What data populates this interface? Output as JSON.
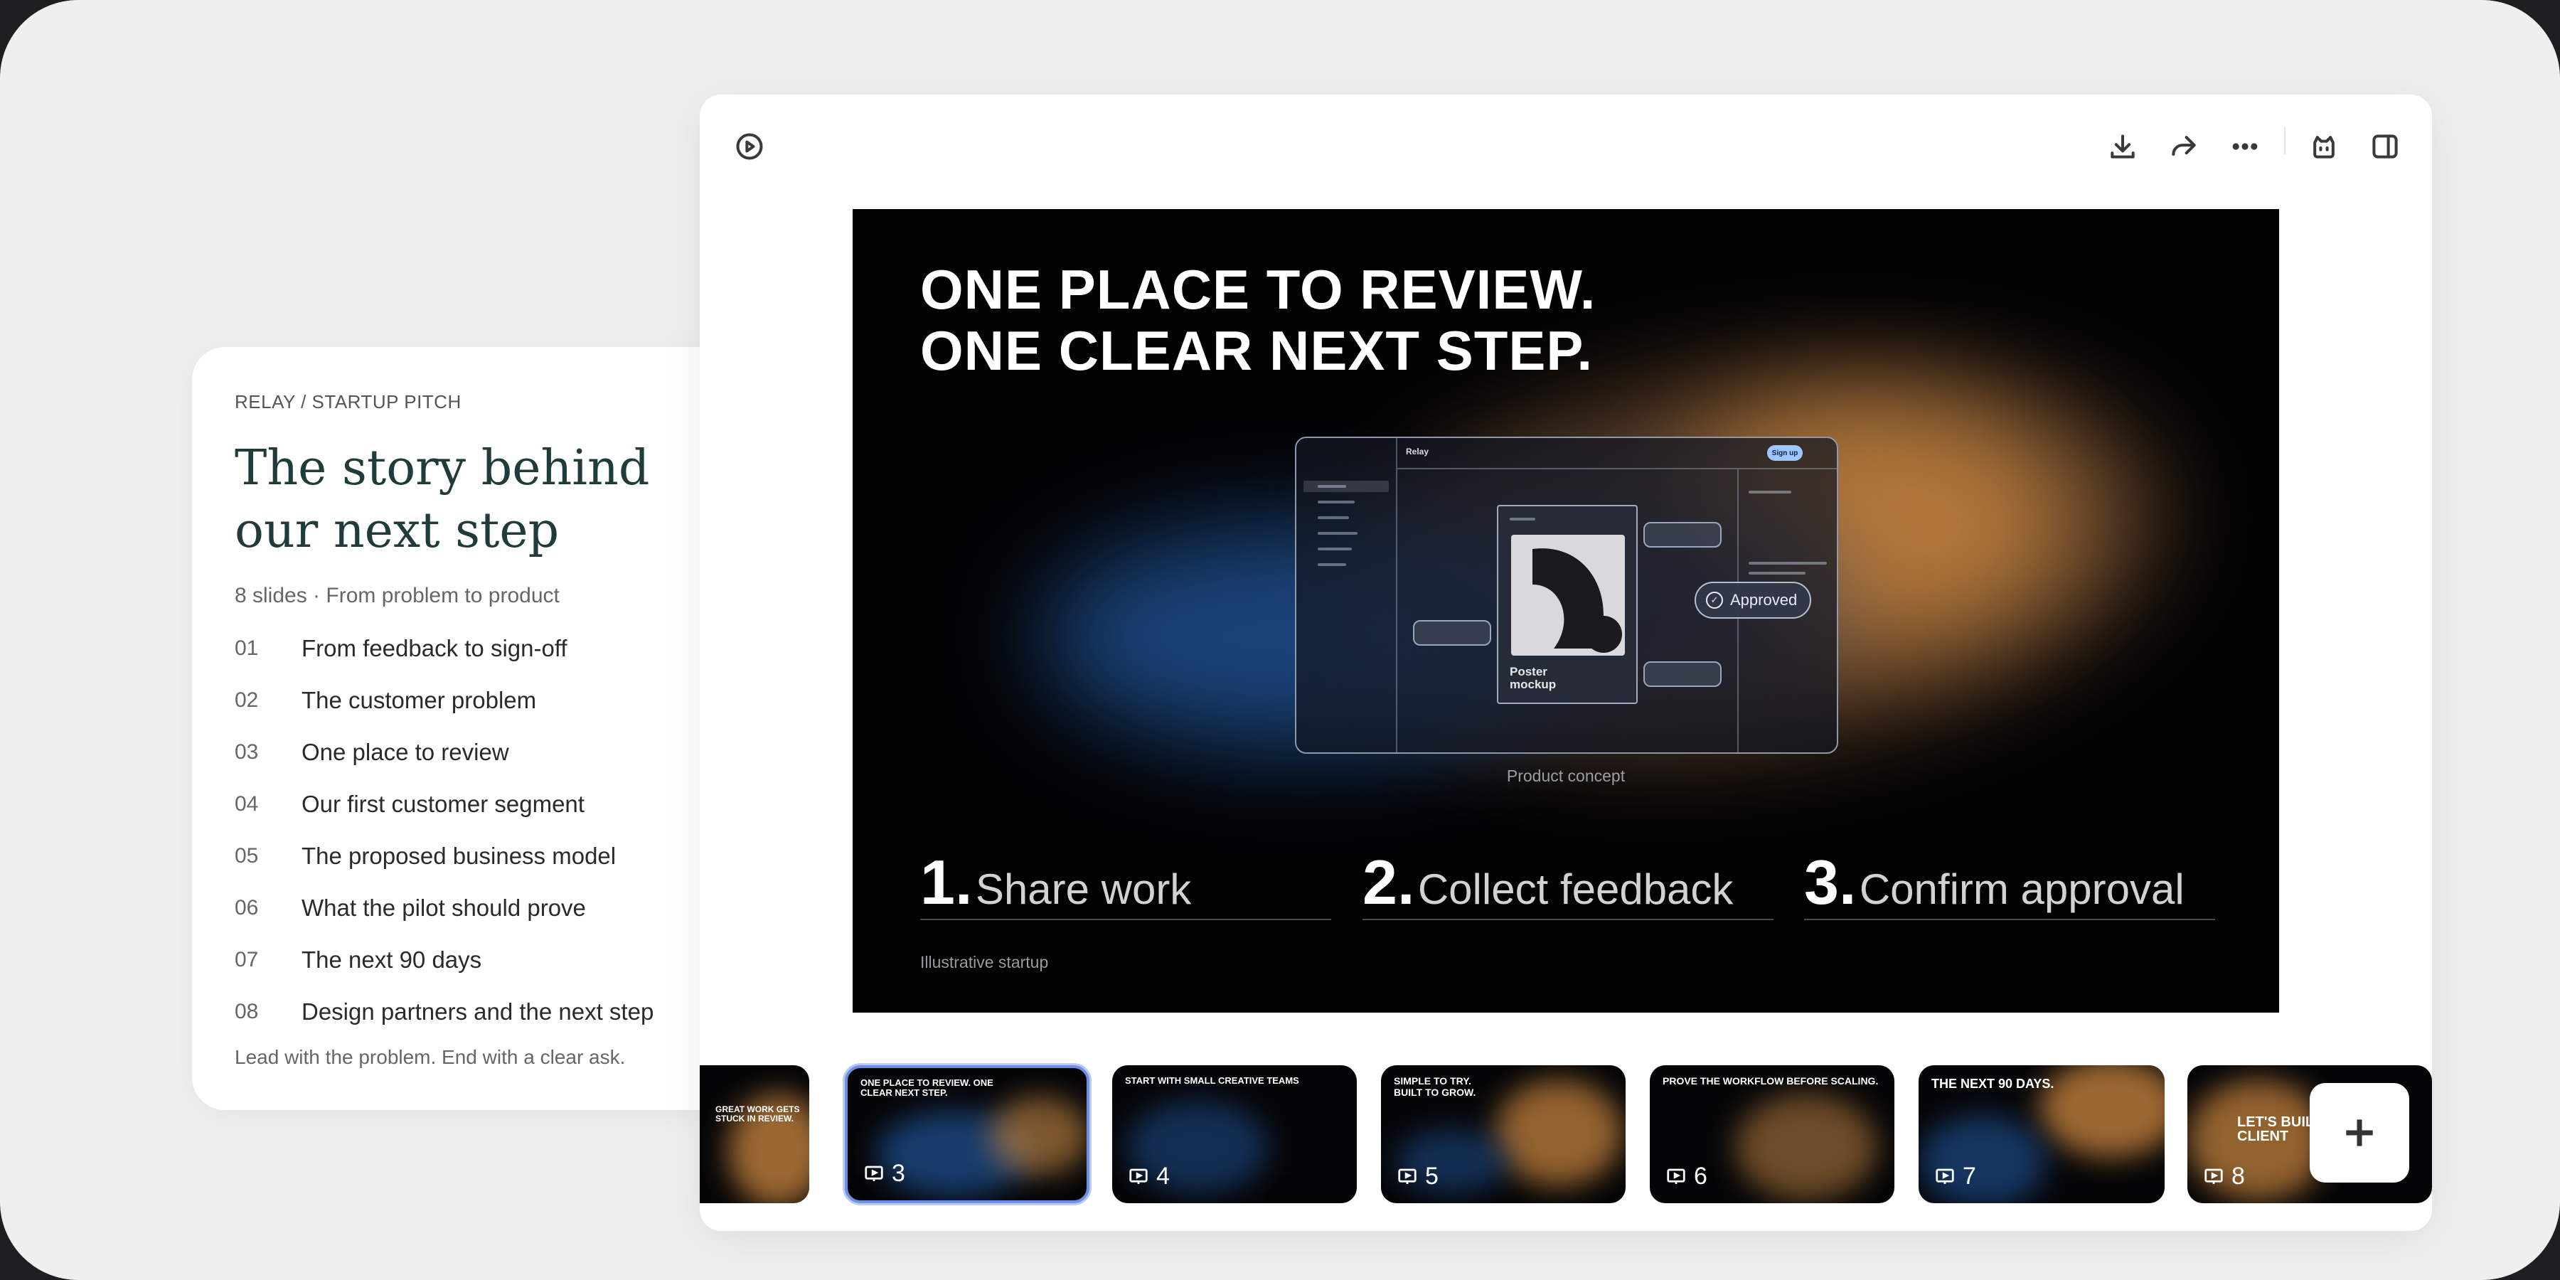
{
  "outline": {
    "eyebrow": "RELAY / STARTUP PITCH",
    "title_line1": "The story behind",
    "title_line2": "our next step",
    "meta": "8 slides · From problem to product",
    "items": [
      {
        "num": "01",
        "label": "From feedback to sign-off"
      },
      {
        "num": "02",
        "label": "The customer problem"
      },
      {
        "num": "03",
        "label": "One place to review"
      },
      {
        "num": "04",
        "label": "Our first customer segment"
      },
      {
        "num": "05",
        "label": "The proposed business model"
      },
      {
        "num": "06",
        "label": "What the pilot should prove"
      },
      {
        "num": "07",
        "label": "The next 90 days"
      },
      {
        "num": "08",
        "label": "Design partners and the next step"
      }
    ],
    "footer": "Lead with the problem. End with a clear ask."
  },
  "toolbar": {
    "icons": [
      "play-icon",
      "download-icon",
      "share-icon",
      "more-icon",
      "assistant-icon",
      "panel-icon"
    ]
  },
  "slide": {
    "headline_line1": "ONE PLACE TO REVIEW.",
    "headline_line2": "ONE CLEAR NEXT STEP.",
    "mock": {
      "brand": "Relay",
      "signup": "Sign up",
      "poster_line1": "Poster",
      "poster_line2": "mockup",
      "approved": "Approved"
    },
    "caption": "Product concept",
    "steps": [
      {
        "num": "1.",
        "label": "Share work"
      },
      {
        "num": "2.",
        "label": "Collect feedback"
      },
      {
        "num": "3.",
        "label": "Confirm approval"
      }
    ],
    "footer": "Illustrative startup"
  },
  "thumbnails": [
    {
      "number": "",
      "title": "GREAT WORK GETS STUCK IN REVIEW."
    },
    {
      "number": "3",
      "title": "ONE PLACE TO REVIEW. ONE CLEAR NEXT STEP.",
      "selected": true
    },
    {
      "number": "4",
      "title": "START WITH SMALL CREATIVE TEAMS"
    },
    {
      "number": "5",
      "title": "SIMPLE TO TRY. BUILT TO GROW."
    },
    {
      "number": "6",
      "title": "PROVE THE WORKFLOW BEFORE SCALING."
    },
    {
      "number": "7",
      "title": "THE NEXT 90 DAYS."
    },
    {
      "number": "8",
      "title": "LET'S BUIL CLIENT"
    }
  ],
  "colors": {
    "accent": "#6f8fe0",
    "outline_title": "#1f3b3a",
    "slide_bg": "#020203"
  }
}
